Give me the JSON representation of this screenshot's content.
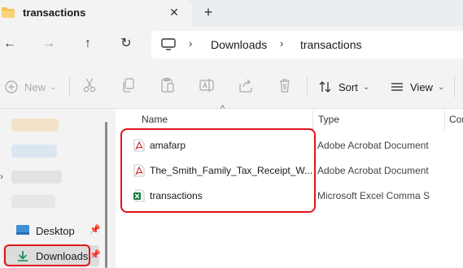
{
  "window": {
    "tab_title": "transactions",
    "tab_close": "✕",
    "new_tab": "+"
  },
  "nav": {
    "back": "←",
    "forward": "→",
    "up": "↑",
    "refresh": "↻"
  },
  "address": {
    "chevron": "›",
    "crumbs": [
      "Downloads",
      "transactions"
    ]
  },
  "commands": {
    "new_label": "New",
    "new_chevron": "⌄",
    "sort_label": "Sort",
    "sort_chevron": "⌄",
    "view_label": "View",
    "view_chevron": "⌄"
  },
  "sidebar": {
    "expand_caret": "›",
    "items": [
      {
        "label": "Desktop",
        "pin": "📌",
        "selected": false
      },
      {
        "label": "Downloads",
        "pin": "📌",
        "selected": true
      }
    ]
  },
  "columns": {
    "sort_indicator": "^",
    "name": "Name",
    "type": "Type",
    "date": "Cor"
  },
  "files": [
    {
      "name": "amafarp",
      "type": "Adobe Acrobat Document",
      "icon": "pdf-icon"
    },
    {
      "name": "The_Smith_Family_Tax_Receipt_W...",
      "type": "Adobe Acrobat Document",
      "icon": "pdf-icon"
    },
    {
      "name": "transactions",
      "type": "Microsoft Excel Comma S",
      "icon": "excel-csv-icon"
    }
  ],
  "colors": {
    "highlight": "#e0151b",
    "pdf_red": "#d32f2f",
    "excel_green": "#1d7a44",
    "folder_yellow": "#f2c14e",
    "selected_bg": "#dcdcdc"
  }
}
